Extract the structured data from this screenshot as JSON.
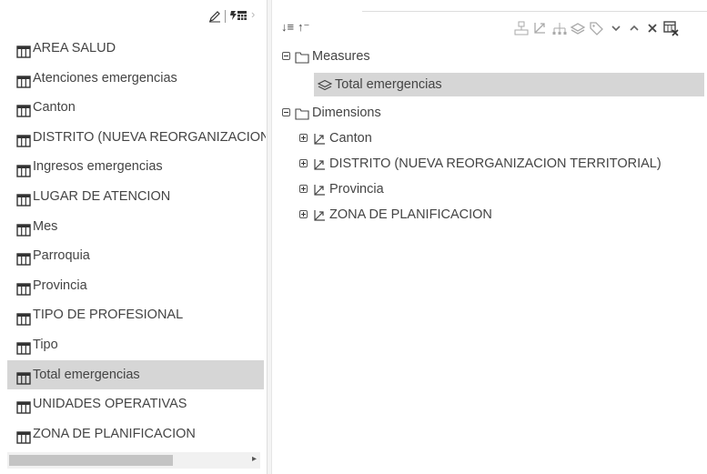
{
  "left_panel": {
    "toolbar": {
      "edit_icon": "pencil-icon",
      "field_icon": "field-table-icon",
      "chevron_icon": "chevron-right-icon",
      "chevron_glyph": "›"
    },
    "fields": [
      {
        "label": "AREA SALUD"
      },
      {
        "label": "Atenciones emergencias"
      },
      {
        "label": "Canton"
      },
      {
        "label": "DISTRITO (NUEVA REORGANIZACION TERRITORIAL)"
      },
      {
        "label": "Ingresos emergencias"
      },
      {
        "label": "LUGAR DE ATENCION"
      },
      {
        "label": "Mes"
      },
      {
        "label": "Parroquia"
      },
      {
        "label": "Provincia"
      },
      {
        "label": "TIPO DE PROFESIONAL"
      },
      {
        "label": "Tipo"
      },
      {
        "label": "Total emergencias"
      },
      {
        "label": "UNIDADES OPERATIVAS"
      },
      {
        "label": "ZONA DE PLANIFICACION"
      }
    ],
    "selected_field": "Total emergencias",
    "scrollbar_arrow": "▸"
  },
  "right_panel": {
    "toolbar": {
      "sort_asc": "↓≡",
      "sort_desc": "↑⁻",
      "icons": [
        "hierarchy-icon",
        "dimension-icon",
        "level-tree-icon",
        "measure-icon",
        "tag-icon",
        "chevron-down-icon",
        "chevron-up-icon",
        "close-icon",
        "delete-table-icon"
      ]
    },
    "tree": {
      "measures": {
        "label": "Measures",
        "items": [
          {
            "label": "Total emergencias"
          }
        ]
      },
      "dimensions": {
        "label": "Dimensions",
        "items": [
          {
            "label": "Canton"
          },
          {
            "label": "DISTRITO (NUEVA REORGANIZACION TERRITORIAL)"
          },
          {
            "label": "Provincia"
          },
          {
            "label": "ZONA DE PLANIFICACION"
          }
        ]
      }
    }
  },
  "colors": {
    "selection": "#d6d6d6",
    "text": "#444444",
    "icon": "#666666"
  }
}
